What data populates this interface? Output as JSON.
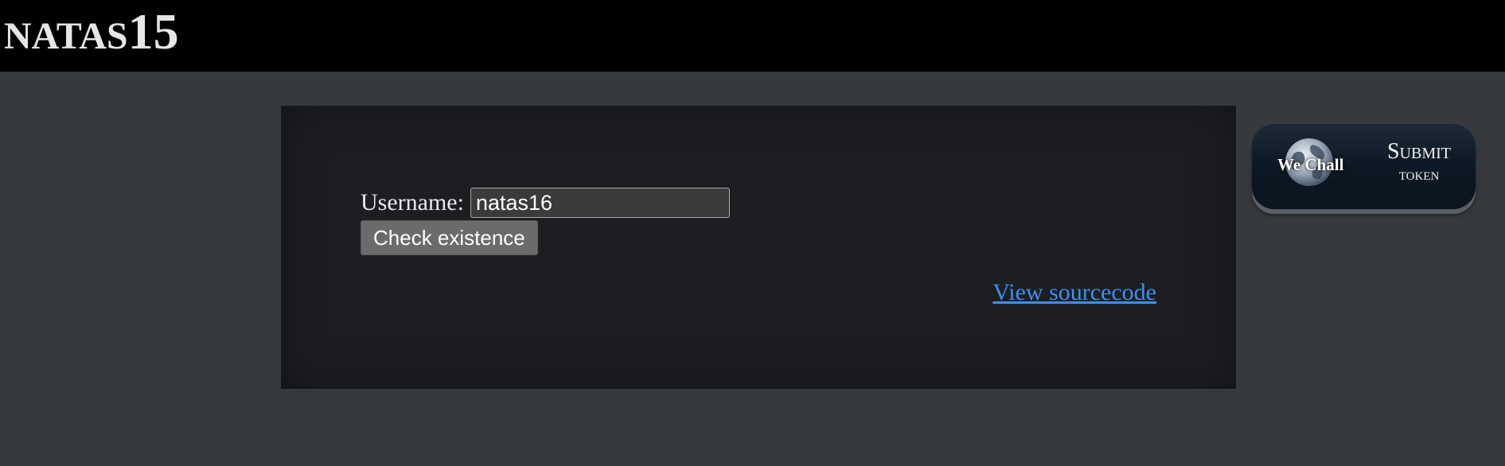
{
  "header": {
    "title_prefix": "NATAS",
    "title_number": "15"
  },
  "form": {
    "username_label": "Username:",
    "username_value": "natas16",
    "submit_label": "Check existence"
  },
  "links": {
    "view_source": "View sourcecode"
  },
  "wechall": {
    "logo_text": "We Chall",
    "submit_line1": "Submit",
    "submit_line2": "token",
    "icon": "globe-icon"
  },
  "colors": {
    "page_bg": "#363a3e",
    "header_bg": "#000000",
    "content_bg": "#1c1e21",
    "link": "#3d8ff0",
    "button_bg": "#6b6b6b"
  }
}
